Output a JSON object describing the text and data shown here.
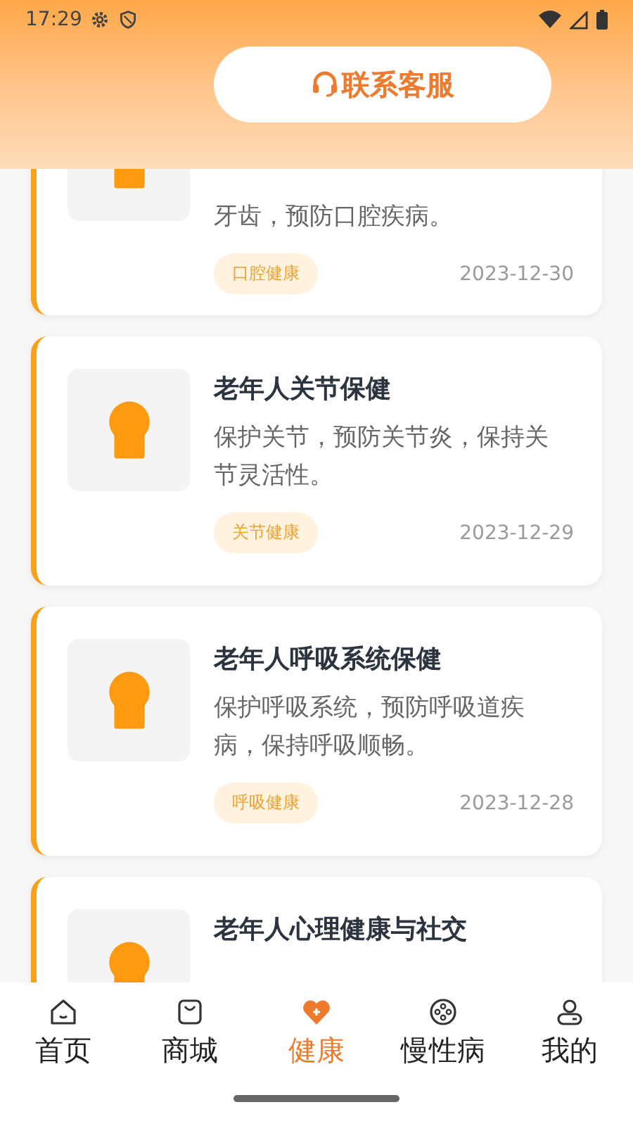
{
  "status_bar": {
    "time": "17:29"
  },
  "header": {
    "service_button": "联系客服"
  },
  "articles": [
    {
      "description": "牙齿，预防口腔疾病。",
      "tag": "口腔健康",
      "date": "2023-12-30"
    },
    {
      "title": "老年人关节保健",
      "description": "保护关节，预防关节炎，保持关节灵活性。",
      "tag": "关节健康",
      "date": "2023-12-29"
    },
    {
      "title": "老年人呼吸系统保健",
      "description": "保护呼吸系统，预防呼吸道疾病，保持呼吸顺畅。",
      "tag": "呼吸健康",
      "date": "2023-12-28"
    },
    {
      "title": "老年人心理健康与社交"
    }
  ],
  "tab_bar": [
    {
      "kind": "home",
      "label": "首页",
      "selected": false
    },
    {
      "kind": "shop",
      "label": "商城",
      "selected": false
    },
    {
      "kind": "health",
      "label": "健康",
      "selected": true
    },
    {
      "kind": "chronic",
      "label": "慢性病",
      "selected": false
    },
    {
      "kind": "profile",
      "label": "我的",
      "selected": false
    }
  ]
}
